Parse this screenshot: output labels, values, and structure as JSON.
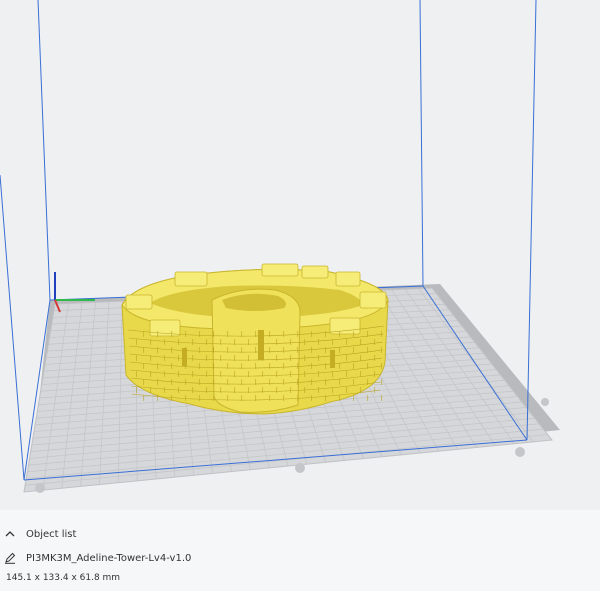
{
  "viewport": {
    "background": "#eef0f2",
    "build_volume_color": "#3a6fd6",
    "plate_color": "#dcdde0",
    "model_color": "#f2e45c"
  },
  "object_list": {
    "header_label": "Object list",
    "collapse_icon": "chevron-up-icon",
    "edit_icon": "pencil-icon",
    "object_name": "PI3MK3M_Adeline-Tower-Lv4-v1.0",
    "dimensions": "145.1 x 133.4 x 61.8 mm"
  }
}
